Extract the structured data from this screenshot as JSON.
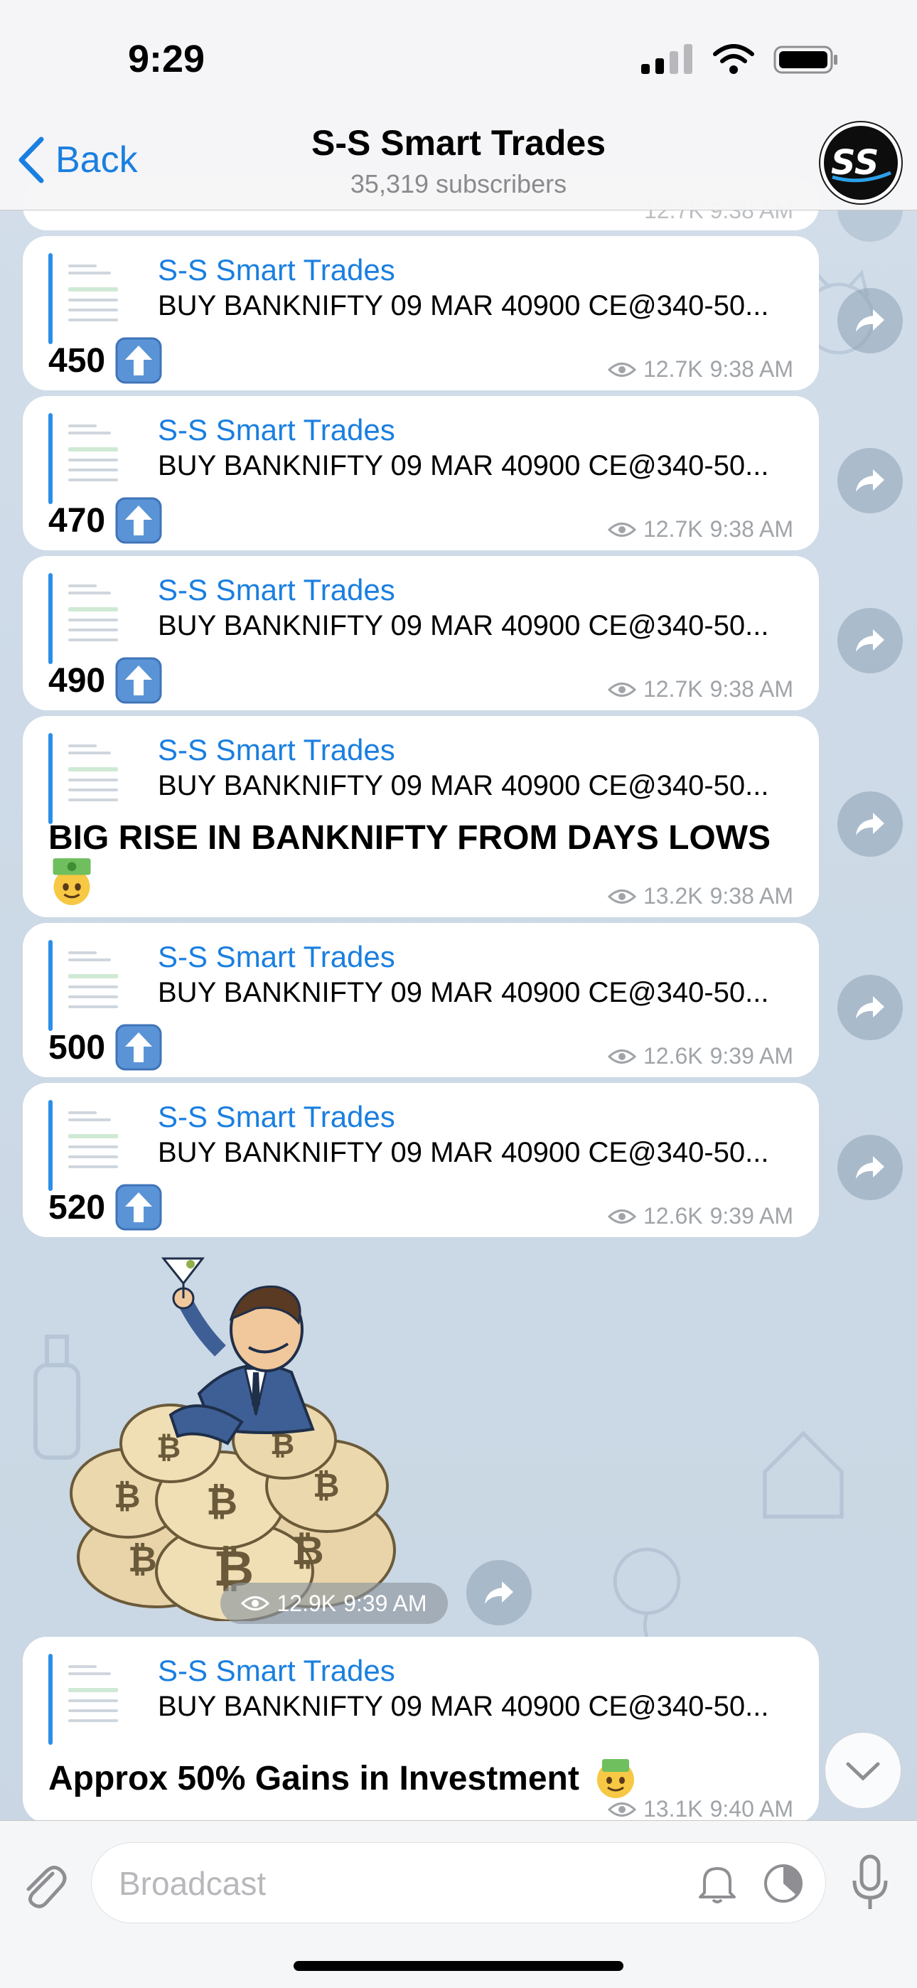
{
  "status_bar": {
    "time": "9:29"
  },
  "header": {
    "back_label": "Back",
    "title": "S-S Smart Trades",
    "subtitle": "35,319 subscribers",
    "avatar_initials": "SS"
  },
  "colors": {
    "accent": "#1a7fe0",
    "bubble": "#ffffff",
    "meta": "#a0a4a8"
  },
  "partial_top_meta": "12.7K 9:38 AM",
  "messages": [
    {
      "quote_name": "S-S Smart Trades",
      "quote_text": "BUY BANKNIFTY 09 MAR 40900 CE@340-50...",
      "text": "450",
      "emoji": "up-arrow",
      "views": "12.7K",
      "time": "9:38 AM"
    },
    {
      "quote_name": "S-S Smart Trades",
      "quote_text": "BUY BANKNIFTY 09 MAR 40900 CE@340-50...",
      "text": "470",
      "emoji": "up-arrow",
      "views": "12.7K",
      "time": "9:38 AM"
    },
    {
      "quote_name": "S-S Smart Trades",
      "quote_text": "BUY BANKNIFTY 09 MAR 40900 CE@340-50...",
      "text": "490",
      "emoji": "up-arrow",
      "views": "12.7K",
      "time": "9:38 AM"
    },
    {
      "quote_name": "S-S Smart Trades",
      "quote_text": "BUY BANKNIFTY 09 MAR 40900 CE@340-50...",
      "text": "BIG RISE IN BANKNIFTY FROM DAYS LOWS",
      "emoji": "money-face",
      "views": "13.2K",
      "time": "9:38 AM"
    },
    {
      "quote_name": "S-S Smart Trades",
      "quote_text": "BUY BANKNIFTY 09 MAR 40900 CE@340-50...",
      "text": "500",
      "emoji": "up-arrow",
      "views": "12.6K",
      "time": "9:39 AM"
    },
    {
      "quote_name": "S-S Smart Trades",
      "quote_text": "BUY BANKNIFTY 09 MAR 40900 CE@340-50...",
      "text": "520",
      "emoji": "up-arrow",
      "views": "12.6K",
      "time": "9:39 AM"
    }
  ],
  "sticker": {
    "views": "12.9K",
    "time": "9:39 AM"
  },
  "last_message": {
    "quote_name": "S-S Smart Trades",
    "quote_text": "BUY BANKNIFTY 09 MAR 40900 CE@340-50...",
    "text": "Approx 50% Gains in Investment",
    "emoji": "money-face",
    "views": "13.1K",
    "time": "9:40 AM"
  },
  "composer": {
    "placeholder": "Broadcast"
  }
}
